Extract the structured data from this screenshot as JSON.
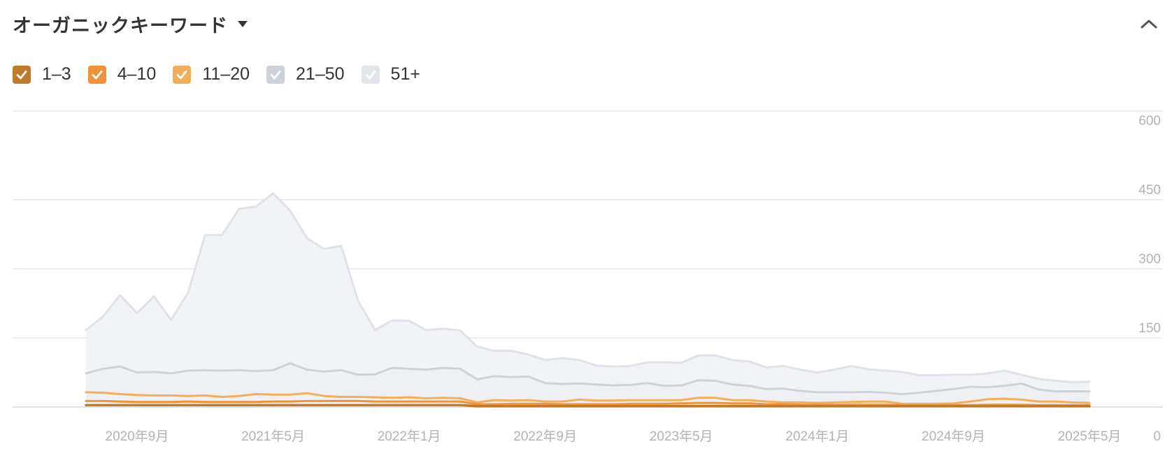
{
  "header": {
    "title": "オーガニックキーワード",
    "dropdown_icon": "caret-down-icon",
    "collapse_icon": "chevron-up-icon"
  },
  "legend": {
    "items": [
      {
        "label": "1–3",
        "color": "#c17a2c",
        "checked": true
      },
      {
        "label": "4–10",
        "color": "#f0923a",
        "checked": true
      },
      {
        "label": "11–20",
        "color": "#f4ad5a",
        "checked": true
      },
      {
        "label": "21–50",
        "color": "#cdd2da",
        "checked": true
      },
      {
        "label": "51+",
        "color": "#e2e5ea",
        "checked": true
      }
    ]
  },
  "chart_data": {
    "type": "area",
    "x_tick_labels": [
      "2020年9月",
      "2021年5月",
      "2022年1月",
      "2022年9月",
      "2023年5月",
      "2024年1月",
      "2024年9月",
      "2025年5月"
    ],
    "y_tick_labels": [
      "0",
      "150",
      "300",
      "450",
      "600"
    ],
    "ylim": [
      0,
      600
    ],
    "grid": true,
    "stacked": false,
    "x_start": "2020年6月",
    "series": [
      {
        "name": "51+",
        "color": "#dfe2e8",
        "fill": "#f2f3f6",
        "values": [
          167,
          196,
          243,
          204,
          240,
          189,
          248,
          373,
          373,
          430,
          435,
          464,
          426,
          366,
          343,
          350,
          230,
          167,
          188,
          187,
          167,
          170,
          166,
          131,
          122,
          122,
          114,
          102,
          106,
          102,
          90,
          88,
          89,
          97,
          97,
          96,
          112,
          112,
          102,
          99,
          86,
          89,
          81,
          75,
          81,
          89,
          82,
          79,
          76,
          69,
          69,
          70,
          70,
          73,
          79,
          70,
          61,
          57,
          54,
          55
        ]
      },
      {
        "name": "21–50",
        "color": "#cdd2da",
        "fill": "#eef0f3",
        "values": [
          73,
          83,
          88,
          75,
          76,
          73,
          79,
          80,
          79,
          80,
          78,
          80,
          95,
          81,
          77,
          80,
          70,
          71,
          85,
          83,
          81,
          85,
          83,
          60,
          67,
          65,
          66,
          52,
          50,
          51,
          49,
          47,
          48,
          52,
          46,
          47,
          58,
          57,
          49,
          46,
          39,
          40,
          35,
          32,
          32,
          32,
          33,
          31,
          28,
          31,
          35,
          39,
          44,
          43,
          46,
          51,
          38,
          34,
          34,
          34
        ]
      },
      {
        "name": "11–20",
        "color": "#f4ad5a",
        "values": [
          32,
          31,
          28,
          26,
          25,
          25,
          24,
          25,
          22,
          24,
          28,
          27,
          27,
          30,
          24,
          22,
          22,
          21,
          20,
          21,
          19,
          20,
          19,
          10,
          15,
          14,
          15,
          12,
          12,
          16,
          14,
          14,
          15,
          15,
          15,
          15,
          20,
          20,
          15,
          15,
          12,
          10,
          10,
          9,
          10,
          11,
          12,
          12,
          7,
          7,
          7,
          8,
          12,
          17,
          18,
          16,
          12,
          12,
          10,
          9
        ]
      },
      {
        "name": "4–10",
        "color": "#f0923a",
        "values": [
          13,
          13,
          12,
          11,
          11,
          11,
          12,
          11,
          11,
          11,
          11,
          12,
          12,
          13,
          13,
          13,
          13,
          12,
          12,
          12,
          12,
          12,
          12,
          6,
          6,
          7,
          7,
          7,
          6,
          6,
          6,
          6,
          7,
          7,
          7,
          8,
          9,
          9,
          8,
          8,
          6,
          6,
          5,
          5,
          5,
          5,
          5,
          5,
          4,
          4,
          4,
          4,
          4,
          5,
          5,
          5,
          4,
          4,
          4,
          4
        ]
      },
      {
        "name": "1–3",
        "color": "#c17a2c",
        "values": [
          4,
          4,
          4,
          4,
          4,
          4,
          4,
          4,
          4,
          4,
          4,
          4,
          4,
          4,
          4,
          4,
          4,
          4,
          4,
          4,
          4,
          4,
          4,
          2,
          2,
          2,
          2,
          2,
          2,
          2,
          2,
          2,
          2,
          2,
          2,
          2,
          2,
          2,
          2,
          2,
          2,
          2,
          2,
          2,
          2,
          2,
          2,
          2,
          2,
          2,
          2,
          2,
          2,
          2,
          2,
          2,
          2,
          2,
          2,
          2
        ]
      }
    ]
  }
}
